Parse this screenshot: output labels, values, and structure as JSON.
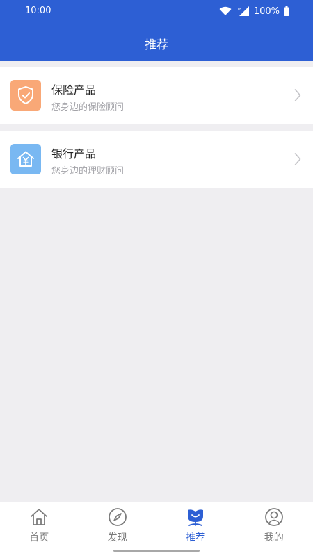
{
  "status_bar": {
    "time": "10:00",
    "battery": "100%",
    "network": "LTE"
  },
  "header": {
    "title": "推荐"
  },
  "products": [
    {
      "title": "保险产品",
      "subtitle": "您身边的保险顾问",
      "icon": "shield-check-icon",
      "color": "#f9a877"
    },
    {
      "title": "银行产品",
      "subtitle": "您身边的理财顾问",
      "icon": "bank-house-icon",
      "color": "#79b8f2"
    }
  ],
  "tabs": [
    {
      "label": "首页",
      "icon": "home-icon",
      "active": false
    },
    {
      "label": "发现",
      "icon": "compass-icon",
      "active": false
    },
    {
      "label": "推荐",
      "icon": "recommend-icon",
      "active": true
    },
    {
      "label": "我的",
      "icon": "profile-icon",
      "active": false
    }
  ],
  "colors": {
    "accent": "#2d5fd4",
    "background": "#efeef1",
    "inactive": "#7b7b7b"
  }
}
